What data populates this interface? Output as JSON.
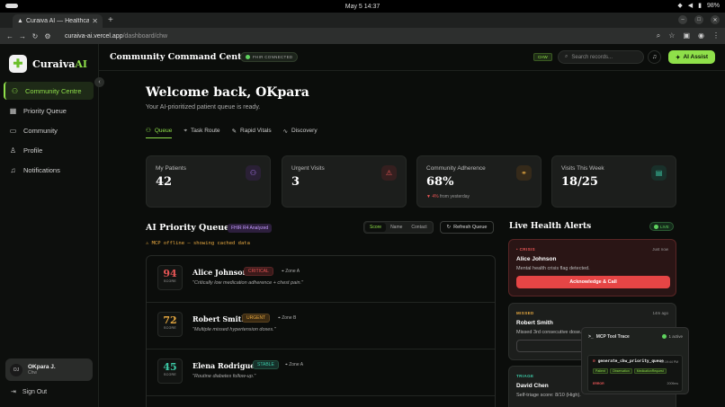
{
  "os": {
    "clock": "May 5  14:37",
    "battery": "98%"
  },
  "browser": {
    "tab_title": "Curaiva AI — Healthcare",
    "url_host": "curaiva-ai.vercel.app",
    "url_path": "/dashboard/chw"
  },
  "sidebar": {
    "logo_text": "Curaiva",
    "logo_accent": "AI",
    "items": [
      {
        "label": "Community Centre",
        "icon": "users-icon"
      },
      {
        "label": "Priority Queue",
        "icon": "grid-icon"
      },
      {
        "label": "Community",
        "icon": "chat-icon"
      },
      {
        "label": "Profile",
        "icon": "user-icon"
      },
      {
        "label": "Notifications",
        "icon": "bell-icon"
      }
    ],
    "user": {
      "initials": "OJ",
      "name": "OKpara J.",
      "role": "Chw"
    },
    "signout": "Sign Out"
  },
  "topbar": {
    "title": "Community Command Centre",
    "fhir_status": "FHIR CONNECTED",
    "role_badge": "CHW",
    "search_placeholder": "Search records...",
    "assist_label": "AI Assist"
  },
  "welcome": {
    "title": "Welcome back, OKpara",
    "subtitle": "Your AI-prioritized patient queue is ready."
  },
  "tabs": [
    {
      "label": "Queue"
    },
    {
      "label": "Task Route"
    },
    {
      "label": "Rapid Vitals"
    },
    {
      "label": "Discovery"
    }
  ],
  "stats": [
    {
      "label": "My Patients",
      "value": "42",
      "sub": "",
      "delta": "",
      "icon": "users-icon",
      "color": "#b27cff",
      "bg": "#2a2035"
    },
    {
      "label": "Urgent Visits",
      "value": "3",
      "sub": "",
      "delta": "",
      "icon": "warning-icon",
      "color": "#e65555",
      "bg": "#351f1f"
    },
    {
      "label": "Community Adherence",
      "value": "68%",
      "sub": "from yesterday",
      "delta": "▼ 4%",
      "icon": "link-icon",
      "color": "#e6a840",
      "bg": "#352a1a"
    },
    {
      "label": "Visits This Week",
      "value": "18/25",
      "sub": "",
      "delta": "",
      "icon": "calendar-icon",
      "color": "#3cc9a6",
      "bg": "#19302a"
    }
  ],
  "queue": {
    "title": "AI Priority Queue",
    "fhir_badge": "FHIR R4 Analyzed",
    "warning": "MCP offline — showing cached data",
    "sort_options": [
      "Score",
      "Name",
      "Contact"
    ],
    "refresh_label": "Refresh Queue",
    "score_label": "SCORE",
    "rows": [
      {
        "score": "94",
        "score_color": "#e65555",
        "name": "Alice Johnson",
        "status": "CRITICAL",
        "status_color": "#e65555",
        "status_bg": "#3a1a1a",
        "zone": "Zone A",
        "note": "\"Critically low medication adherence + chest pain.\""
      },
      {
        "score": "72",
        "score_color": "#e6a840",
        "name": "Robert Smith",
        "status": "URGENT",
        "status_color": "#e6a840",
        "status_bg": "#3a2a12",
        "zone": "Zone B",
        "note": "\"Multiple missed hypertension doses.\""
      },
      {
        "score": "45",
        "score_color": "#3cc9a6",
        "name": "Elena Rodriguez",
        "status": "STABLE",
        "status_color": "#3cc9a6",
        "status_bg": "#16302a",
        "zone": "Zone A",
        "note": "\"Routine diabetes follow-up.\""
      }
    ]
  },
  "alerts": {
    "title": "Live Health Alerts",
    "live_label": "LIVE",
    "items": [
      {
        "kind": "• CRISIS",
        "kind_color": "#e65555",
        "time": "Just now",
        "name": "Alice Johnson",
        "msg": "Mental health crisis flag detected.",
        "action": "Acknowledge & Call"
      },
      {
        "kind": "MISSED",
        "kind_color": "#e6a840",
        "time": "14m ago",
        "name": "Robert Smith",
        "msg": "Missed 3rd consecutive dose.",
        "action": "Ac"
      },
      {
        "kind": "TRIAGE",
        "kind_color": "#3cc9a6",
        "time": "",
        "name": "David Chen",
        "msg": "Self-triage score: 8/10 (High).",
        "action": ""
      }
    ]
  },
  "mcp": {
    "title": "MCP Tool Trace",
    "active": "1 active",
    "fn": "generate_chw_priority_queue",
    "time": "02:19:44 PM",
    "tags": [
      "Patient",
      "Observation",
      "MedicationRequest"
    ],
    "status": "ERROR",
    "duration": "2009ms"
  }
}
